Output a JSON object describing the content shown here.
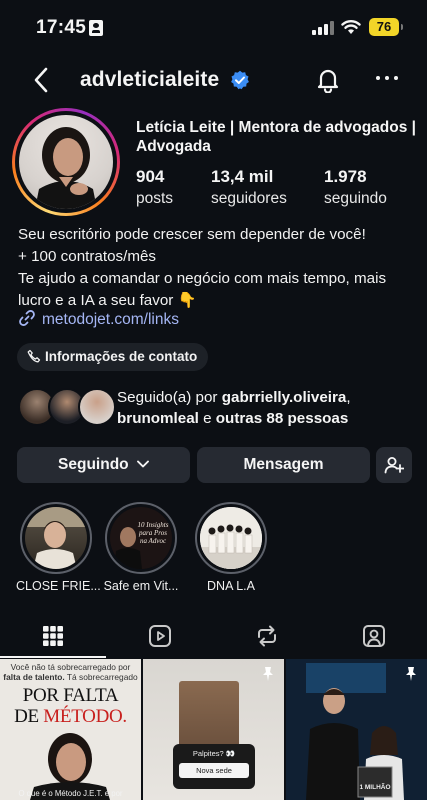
{
  "status_bar": {
    "time": "17:45",
    "battery": "76"
  },
  "header": {
    "username": "advleticialeite"
  },
  "profile": {
    "display_name": "Letícia Leite | Mentora de advogados | Advogada",
    "stats": [
      {
        "value": "904",
        "label": "posts"
      },
      {
        "value": "13,4 mil",
        "label": "seguidores"
      },
      {
        "value": "1.978",
        "label": "seguindo"
      }
    ],
    "bio": [
      "Seu escritório pode crescer sem depender de você!",
      "+ 100 contratos/mês",
      "Te ajudo a comandar o negócio com mais tempo, mais lucro e a IA a seu favor 👇"
    ],
    "link": "metodojet.com/links",
    "contact_label": "Informações de contato",
    "followed_by": {
      "prefix": "Seguido(a) por",
      "user1": "gabrrielly.oliveira",
      "user2": "brunomleal",
      "middle": "e",
      "others": "outras 88 pessoas"
    }
  },
  "actions": {
    "following": "Seguindo",
    "message": "Mensagem"
  },
  "highlights": [
    {
      "label": "CLOSE FRIE..."
    },
    {
      "label": "Safe em Vit..."
    },
    {
      "label": "DNA L.A"
    }
  ],
  "highlight_art": {
    "safe_text": "10 Insights para Pros na Advoc"
  },
  "posts": [
    {
      "top_line": "Você não tá sobrecarregado por",
      "top_line_bold": "falta de talento.",
      "top_line_rest": "Tá sobrecarregado",
      "headline1": "POR FALTA",
      "headline2_prefix": "DE",
      "headline2_accent": "MÉTODO.",
      "footer": "O que é o Método J.E.T. e por"
    },
    {
      "poll_title": "Palpites? 👀",
      "poll_option": "Nova sede"
    },
    {
      "badge": "1 MILHÃO"
    }
  ],
  "colors": {
    "background": "#0c0f14",
    "button": "#262a32",
    "link": "#a5b6f4",
    "verified": "#3b8df5",
    "accent_red": "#c8201e"
  }
}
